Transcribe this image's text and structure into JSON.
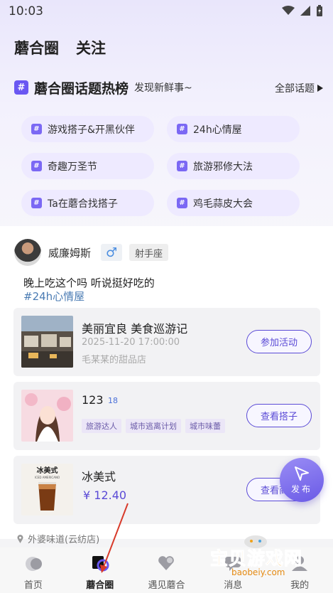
{
  "status_bar": {
    "time": "10:03"
  },
  "top_tabs": [
    {
      "label": "蘑合圈",
      "active": true
    },
    {
      "label": "关注",
      "active": false
    }
  ],
  "topics": {
    "hash": "#",
    "title": "蘑合圈话题热榜",
    "subtitle": "发现新鲜事~",
    "all_label": "全部话题",
    "chips": [
      "游戏搭子&开黑伙伴",
      "24h心情屋",
      "奇趣万圣节",
      "旅游邪修大法",
      "Ta在蘑合找搭子",
      "鸡毛蒜皮大会"
    ]
  },
  "post": {
    "author": "威廉姆斯",
    "gender_symbol": "♂",
    "zodiac": "射手座",
    "text": "晚上吃这个吗 听说挺好吃的",
    "tag": "#24h心情屋",
    "activity_card": {
      "title": "美丽宜良 美食巡游记",
      "time": "2025-11-20 17:00:00",
      "place": "毛某某的甜品店",
      "button": "参加活动"
    },
    "buddy_card": {
      "title": "123",
      "count": "18",
      "tags": [
        "旅游达人",
        "城市逃离计划",
        "城市味蕾"
      ],
      "button": "查看搭子"
    },
    "product_card": {
      "title": "冰美式",
      "thumb_text": "冰美式",
      "thumb_sub": "ICED AMERICANO",
      "price": "¥ 12.40",
      "button": "查看商品"
    },
    "location": "外婆味道(云纺店)"
  },
  "fab": {
    "label": "发布"
  },
  "bottom_nav": [
    {
      "label": "首页",
      "icon": "home-icon"
    },
    {
      "label": "蘑合圈",
      "icon": "circle-icon",
      "active": true
    },
    {
      "label": "遇见蘑合",
      "icon": "heart-icon"
    },
    {
      "label": "消息",
      "icon": "message-icon"
    },
    {
      "label": "我的",
      "icon": "profile-icon"
    }
  ],
  "watermark": {
    "text": "宝贝游戏网",
    "url": "baobeiy.com"
  },
  "colors": {
    "accent": "#6a57f2",
    "chip_bg": "#eeeaff",
    "link": "#4a7bb3"
  }
}
